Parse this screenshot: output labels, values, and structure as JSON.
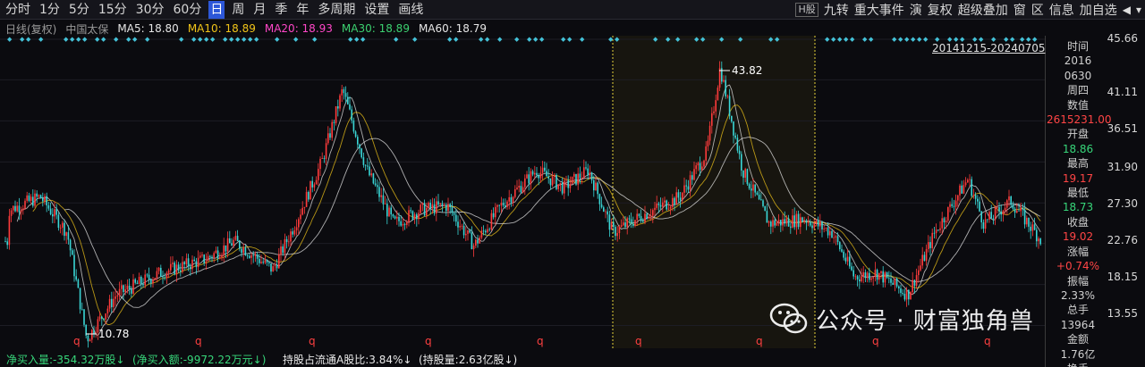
{
  "toolbar": {
    "periods": [
      "分时",
      "1分",
      "5分",
      "15分",
      "30分",
      "60分",
      "日",
      "周",
      "月",
      "季",
      "年",
      "多周期",
      "设置",
      "画线"
    ],
    "active_period": "日",
    "right_h": "H股",
    "right_items": [
      "九转",
      "重大事件",
      "演",
      "复权",
      "超级叠加",
      "窗",
      "区",
      "信息",
      "加自选"
    ],
    "right_arrow": "◀",
    "right_arrow2": "▾"
  },
  "ma_line": {
    "kline_label": "日线(复权)",
    "stock_name": "中国太保",
    "ma5": "MA5: 18.80",
    "ma10": "MA10: 18.89",
    "ma20": "MA20: 18.93",
    "ma30": "MA30: 18.89",
    "ma60": "MA60: 18.79",
    "colors": {
      "ma5": "#e6e6e6",
      "ma10": "#f0c419",
      "ma20": "#ff47c8",
      "ma30": "#3cd070",
      "ma60": "#e6e6e6"
    }
  },
  "range_label": "20141215-20240705",
  "y_axis_labels": [
    "45.66",
    "41.11",
    "36.51",
    "31.90",
    "27.30",
    "22.76",
    "18.15",
    "13.55"
  ],
  "info_panel": {
    "time_label": "时间",
    "year": "2016",
    "date": "0630",
    "weekday": "周四",
    "value_label": "数值",
    "value": "2615231.00",
    "open_label": "开盘",
    "open": "18.86",
    "high_label": "最高",
    "high": "19.17",
    "low_label": "最低",
    "low": "18.73",
    "close_label": "收盘",
    "close": "19.02",
    "change_label": "涨幅",
    "change": "+0.74%",
    "amplitude_label": "振幅",
    "amplitude": "2.33%",
    "volume_label": "总手",
    "volume": "13964",
    "amount_label": "金额",
    "amount": "1.76亿",
    "turnover_label": "换手"
  },
  "annotations": {
    "max_label": "43.82",
    "min_label": "10.78",
    "q_marker": "q",
    "marker_char": "◆"
  },
  "bottom_bar": {
    "net_buy_volume": "净买入量:-354.32万股↓",
    "net_buy_amount": "(净买入额:-9972.22万元↓)",
    "hold_ratio": "持股占流通A股比:3.84%↓",
    "hold_volume": "(持股量:2.63亿股↓)"
  },
  "watermark": {
    "text": "公众号 · 财富独角兽",
    "icon": "wechat-icon"
  },
  "colors": {
    "up": "#ff3b3b",
    "down": "#3ad6d6",
    "marker": "#44c2d8",
    "highlight_line": "#e6d23a",
    "watermark": "#ffffff"
  }
}
